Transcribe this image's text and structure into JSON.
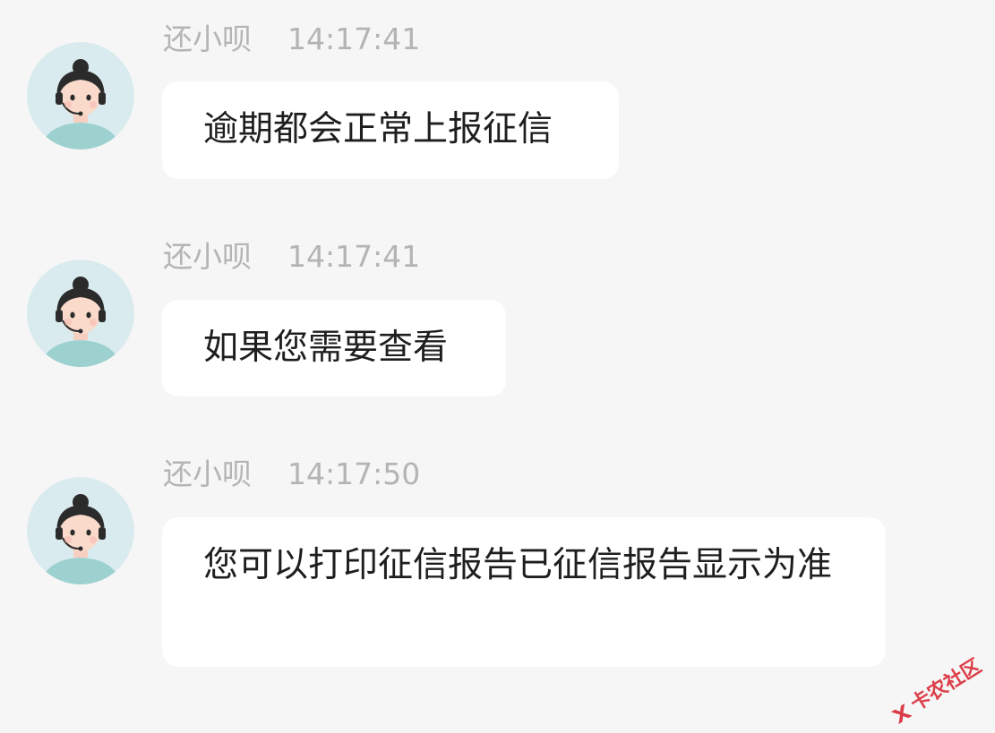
{
  "messages": [
    {
      "sender": "还小呗",
      "time": "14:17:41",
      "text": "逾期都会正常上报征信"
    },
    {
      "sender": "还小呗",
      "time": "14:17:41",
      "text": "如果您需要查看"
    },
    {
      "sender": "还小呗",
      "time": "14:17:50",
      "text": "您可以打印征信报告已征信报告显示为准"
    }
  ],
  "watermark": {
    "text": "卡农社区"
  },
  "colors": {
    "background": "#f6f6f6",
    "bubble": "#ffffff",
    "meta_text": "#b4b4b4",
    "message_text": "#1e1e1e",
    "avatar_bg": "#d9ebee",
    "avatar_shirt": "#9dd1cf",
    "watermark": "#d81e2c"
  },
  "icons": {
    "avatar": "customer-service-agent-avatar-icon",
    "watermark": "kanong-logo-icon"
  }
}
